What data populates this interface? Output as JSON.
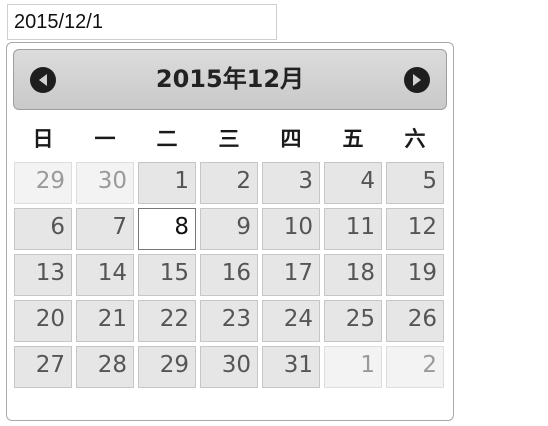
{
  "input": {
    "value": "2015/12/1"
  },
  "datepicker": {
    "title": "2015年12月",
    "prev_icon": "circle-arrow-left-icon",
    "next_icon": "circle-arrow-right-icon",
    "weekdays": [
      "日",
      "一",
      "二",
      "三",
      "四",
      "五",
      "六"
    ],
    "weeks": [
      [
        {
          "label": "29",
          "state": "other"
        },
        {
          "label": "30",
          "state": "other"
        },
        {
          "label": "1",
          "state": "normal"
        },
        {
          "label": "2",
          "state": "normal"
        },
        {
          "label": "3",
          "state": "normal"
        },
        {
          "label": "4",
          "state": "normal"
        },
        {
          "label": "5",
          "state": "normal"
        }
      ],
      [
        {
          "label": "6",
          "state": "normal"
        },
        {
          "label": "7",
          "state": "normal"
        },
        {
          "label": "8",
          "state": "active"
        },
        {
          "label": "9",
          "state": "normal"
        },
        {
          "label": "10",
          "state": "normal"
        },
        {
          "label": "11",
          "state": "normal"
        },
        {
          "label": "12",
          "state": "normal"
        }
      ],
      [
        {
          "label": "13",
          "state": "normal"
        },
        {
          "label": "14",
          "state": "normal"
        },
        {
          "label": "15",
          "state": "normal"
        },
        {
          "label": "16",
          "state": "normal"
        },
        {
          "label": "17",
          "state": "normal"
        },
        {
          "label": "18",
          "state": "normal"
        },
        {
          "label": "19",
          "state": "normal"
        }
      ],
      [
        {
          "label": "20",
          "state": "normal"
        },
        {
          "label": "21",
          "state": "normal"
        },
        {
          "label": "22",
          "state": "normal"
        },
        {
          "label": "23",
          "state": "normal"
        },
        {
          "label": "24",
          "state": "normal"
        },
        {
          "label": "25",
          "state": "normal"
        },
        {
          "label": "26",
          "state": "normal"
        }
      ],
      [
        {
          "label": "27",
          "state": "normal"
        },
        {
          "label": "28",
          "state": "normal"
        },
        {
          "label": "29",
          "state": "normal"
        },
        {
          "label": "30",
          "state": "normal"
        },
        {
          "label": "31",
          "state": "normal"
        },
        {
          "label": "1",
          "state": "other"
        },
        {
          "label": "2",
          "state": "other"
        }
      ]
    ]
  },
  "colors": {
    "header_bg": "#d3d3d3",
    "day_bg": "#e6e6e6",
    "other_month_text": "#9a9a9a",
    "active_day_bg": "#ffffff"
  }
}
